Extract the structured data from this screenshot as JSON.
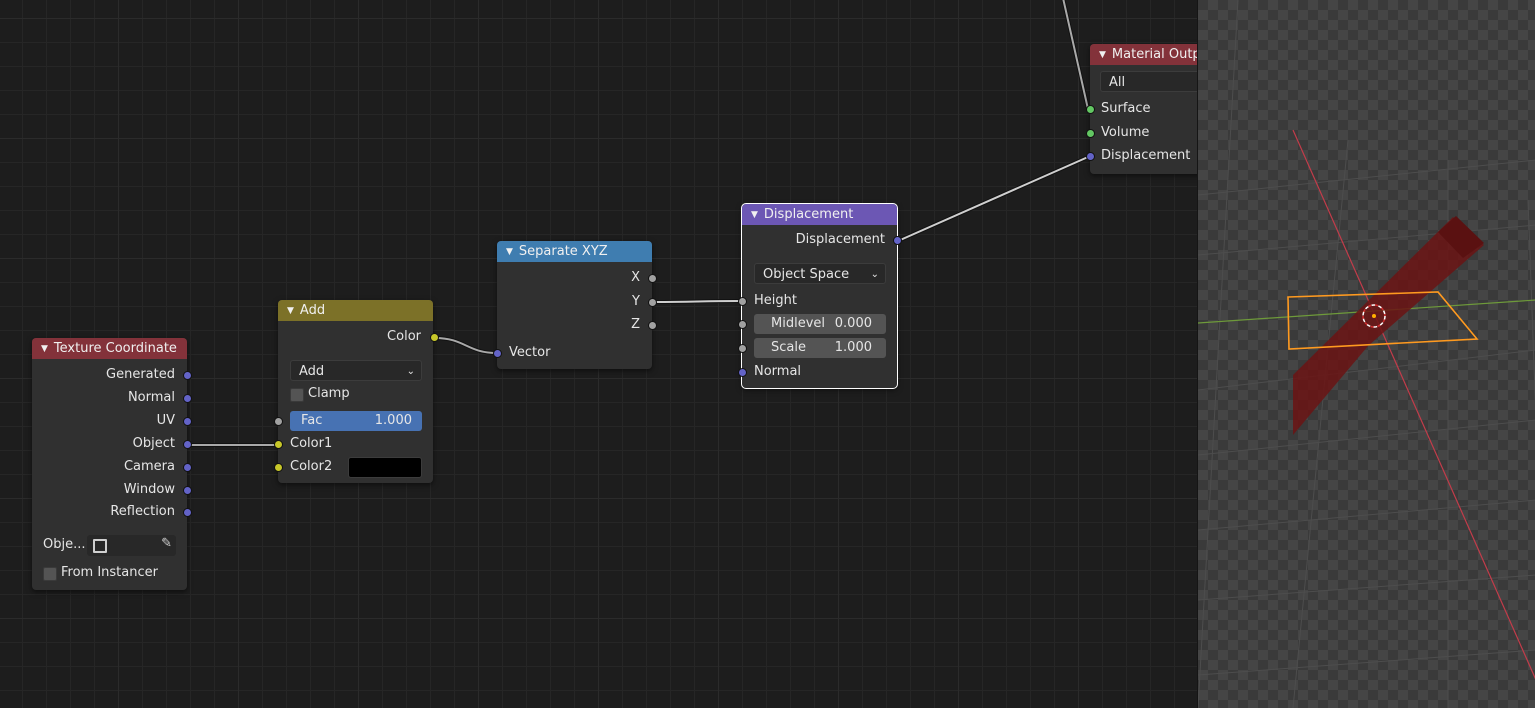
{
  "nodes": {
    "texture_coordinate": {
      "title": "Texture Coordinate",
      "outputs": [
        "Generated",
        "Normal",
        "UV",
        "Object",
        "Camera",
        "Window",
        "Reflection"
      ],
      "object_label": "Obje...",
      "from_instancer_label": "From Instancer"
    },
    "add": {
      "title": "Add",
      "output": "Color",
      "blend_mode": "Add",
      "clamp_label": "Clamp",
      "fac_label": "Fac",
      "fac_value": "1.000",
      "color1_label": "Color1",
      "color2_label": "Color2",
      "color2_swatch": "#000000"
    },
    "separate_xyz": {
      "title": "Separate XYZ",
      "outputs": [
        "X",
        "Y",
        "Z"
      ],
      "input": "Vector"
    },
    "displacement": {
      "title": "Displacement",
      "output": "Displacement",
      "space": "Object Space",
      "height_label": "Height",
      "midlevel_label": "Midlevel",
      "midlevel_value": "0.000",
      "scale_label": "Scale",
      "scale_value": "1.000",
      "normal_label": "Normal"
    },
    "material_output": {
      "title": "Material Outp",
      "target": "All",
      "inputs": [
        "Surface",
        "Volume",
        "Displacement"
      ]
    }
  },
  "colors": {
    "header_input": "#83323a",
    "header_color": "#7c7128",
    "header_converter": "#3f7db0",
    "header_vector": "#6c57b4",
    "header_output": "#83323a",
    "socket_vector": "#6363c7",
    "socket_color": "#c7c729",
    "socket_float": "#a1a1a1",
    "socket_shader": "#63c763",
    "fac_field": "#4772b3",
    "selection_outline": "#ff9a1f",
    "x_axis": "#c23c4a",
    "y_axis": "#6e9a3a"
  },
  "icons": [
    "collapse-triangle-icon",
    "chevron-down-icon",
    "object-icon",
    "eyedropper-icon",
    "origin-marker-icon"
  ]
}
